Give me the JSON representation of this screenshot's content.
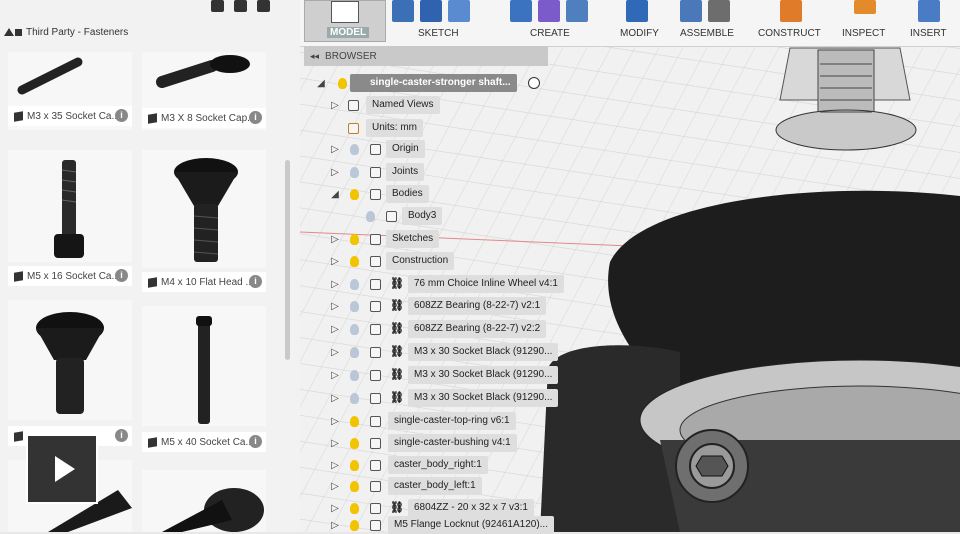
{
  "left_panel": {
    "breadcrumb": "Third Party - Fasteners",
    "parts": [
      {
        "label": "M3 x 35 Socket Ca..."
      },
      {
        "label": "M3 X 8 Socket Cap..."
      },
      {
        "label": "M5 x 16 Socket Ca..."
      },
      {
        "label": "M4 x 10 Flat Head ..."
      },
      {
        "label": "M5 x 40 Socket Ca..."
      }
    ]
  },
  "toolbar": {
    "model": "MODEL",
    "groups": [
      "SKETCH",
      "CREATE",
      "MODIFY",
      "ASSEMBLE",
      "CONSTRUCT",
      "INSPECT",
      "INSERT"
    ]
  },
  "browser": {
    "title": "BROWSER",
    "root": "single-caster-stronger shaft...",
    "items": [
      {
        "label": "Named Views"
      },
      {
        "label": "Units: mm"
      },
      {
        "label": "Origin"
      },
      {
        "label": "Joints"
      },
      {
        "label": "Bodies"
      },
      {
        "label": "Body3"
      },
      {
        "label": "Sketches"
      },
      {
        "label": "Construction"
      },
      {
        "label": "76 mm Choice Inline Wheel v4:1"
      },
      {
        "label": "608ZZ Bearing (8-22-7) v2:1"
      },
      {
        "label": "608ZZ Bearing (8-22-7) v2:2"
      },
      {
        "label": "M3 x 30 Socket Black (91290..."
      },
      {
        "label": "M3 x 30 Socket Black (91290..."
      },
      {
        "label": "M3 x 30 Socket Black (91290..."
      },
      {
        "label": "single-caster-top-ring v6:1"
      },
      {
        "label": "single-caster-bushing v4:1"
      },
      {
        "label": "caster_body_right:1"
      },
      {
        "label": "caster_body_left:1"
      },
      {
        "label": "6804ZZ - 20 x 32 x 7 v3:1"
      },
      {
        "label": "M5 Flange Locknut (92461A120)..."
      }
    ]
  },
  "colors": {
    "bulb_on": "#f2c400",
    "bulb_off": "#b9c7d6",
    "panel": "#f2f2f2"
  }
}
